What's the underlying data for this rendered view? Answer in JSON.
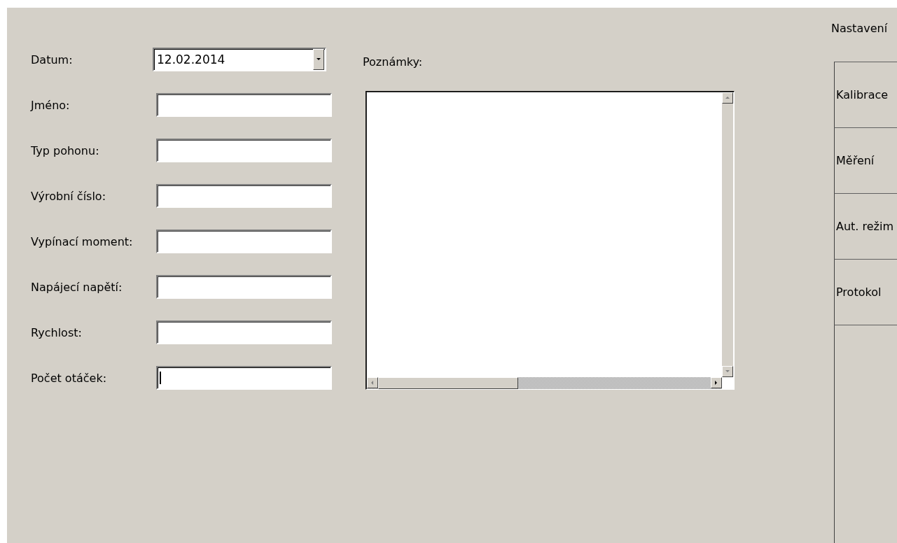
{
  "date_field": {
    "label": "Datum:",
    "value": "12.02.2014"
  },
  "fields": [
    {
      "label": "Jméno:",
      "focused": false
    },
    {
      "label": "Typ pohonu:",
      "focused": false
    },
    {
      "label": "Výrobní číslo:",
      "focused": false
    },
    {
      "label": "Vypínací moment:",
      "focused": false
    },
    {
      "label": "Napájecí napětí:",
      "focused": false
    },
    {
      "label": "Rychlost:",
      "focused": false
    },
    {
      "label": "Počet otáček:",
      "focused": true
    }
  ],
  "notes": {
    "label": "Poznámky:"
  },
  "tabs": [
    {
      "label": "Nastavení",
      "selected": true
    },
    {
      "label": "Kalibrace",
      "selected": false
    },
    {
      "label": "Měření",
      "selected": false
    },
    {
      "label": "Aut. režim",
      "selected": false
    },
    {
      "label": "Protokol",
      "selected": false
    }
  ]
}
